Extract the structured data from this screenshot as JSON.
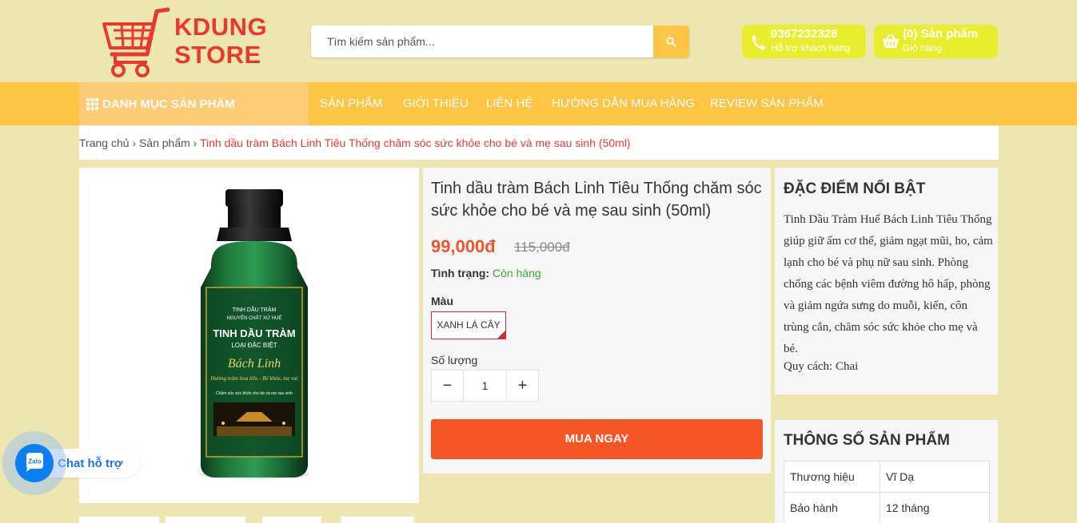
{
  "brand": {
    "logo_line1": "KDUNG",
    "logo_line2": "STORE"
  },
  "search": {
    "placeholder": "Tìm kiếm sản phẩm..."
  },
  "hotline": {
    "phone": "0367232328",
    "caption": "Hỗ trợ khách hàng"
  },
  "cart": {
    "count_label": "(0) Sản phẩm",
    "caption": "Giỏ hàng"
  },
  "nav": {
    "category_label": "DANH MỤC SẢN PHẨM",
    "items": [
      "SẢN PHẨM",
      "GIỚI THIỆU",
      "LIÊN HỆ",
      "HƯỚNG DẪN MUA HÀNG",
      "REVIEW SẢN PHẨM"
    ]
  },
  "breadcrumb": {
    "home": "Trang chủ",
    "sep": " › ",
    "section": "Sản phẩm",
    "current": "Tinh dầu tràm Bách Linh Tiêu Thống chăm sóc sức khỏe cho bé và mẹ sau sinh (50ml)"
  },
  "product": {
    "title": "Tinh dầu tràm Bách Linh Tiêu Thống chăm sóc sức khỏe cho bé và mẹ sau sinh (50ml)",
    "price": "99,000đ",
    "old_price": "115,000đ",
    "status_label": "Tình trạng:",
    "status_value": "Còn hàng",
    "color_label": "Màu",
    "color_value": "XANH LÁ CÂY",
    "qty_label": "Số lượng",
    "qty_value": "1",
    "qty_minus": "−",
    "qty_plus": "+",
    "buy_label": "MUA NGAY",
    "bottle_label": {
      "line1": "TINH DẦU TRÀM",
      "line2": "NGUYÊN CHẤT XỨ HUẾ",
      "line3": "TINH DẦU TRÀM",
      "line4": "LOẠI ĐẶC BIỆT",
      "line5": "Bách Linh",
      "line6": "Hương tràm hoa tiêu - Bé khỏe, mẹ vui",
      "line7": "Chăm sóc sức khỏe cho bé và mẹ sau sinh"
    }
  },
  "features": {
    "title": "ĐẶC ĐIỂM NỔI BẬT",
    "text": "Tinh Dầu Tràm Huế Bách Linh Tiêu Thống giúp giữ ấm cơ thể, giảm ngạt mũi, ho, cảm lạnh cho bé và phụ nữ sau sinh. Phòng chống các bệnh viêm đường hô hấp, phòng và giảm ngứa sưng do muỗi, kiến, côn trùng cắn, chăm sóc sức khỏe cho mẹ và bé.",
    "spec_line": "Quy cách:  Chai"
  },
  "specs": {
    "title": "THÔNG SỐ SẢN PHẨM",
    "rows": [
      {
        "label": "Thương hiệu",
        "value": "Vĩ Dạ"
      },
      {
        "label": "Bảo hành",
        "value": "12 tháng"
      }
    ]
  },
  "chat": {
    "icon_text": "Zalo",
    "label": "Chat hỗ trợ"
  },
  "colors": {
    "accent": "#fdc543",
    "brand_red": "#e8392f",
    "buy": "#f65625",
    "pill": "#e8ee2e"
  }
}
